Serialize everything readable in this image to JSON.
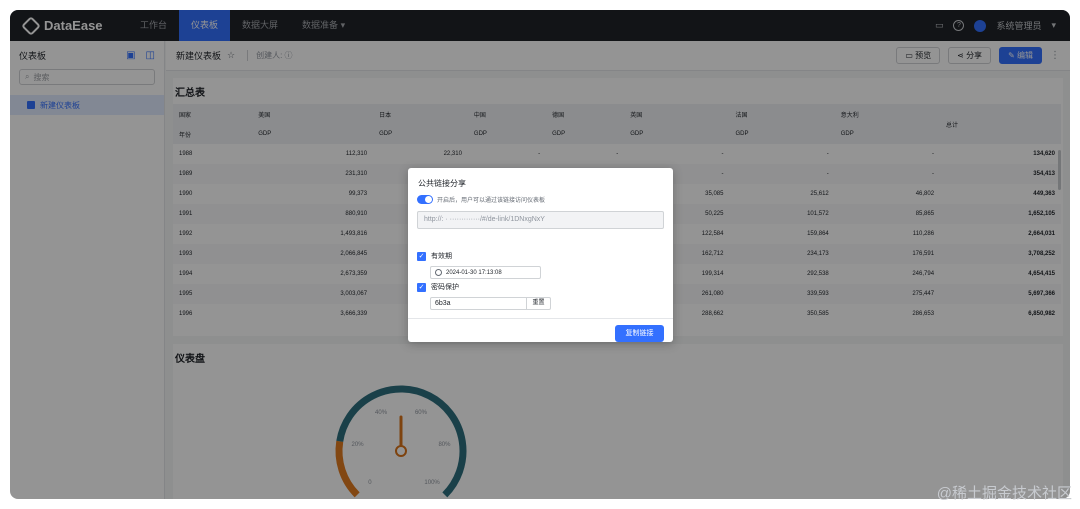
{
  "brand": {
    "name": "DataEase"
  },
  "nav": {
    "items": [
      {
        "label": "工作台",
        "active": false
      },
      {
        "label": "仪表板",
        "active": true
      },
      {
        "label": "数据大屏",
        "active": false
      },
      {
        "label": "数据准备",
        "active": false
      }
    ],
    "user_name": "系统管理员"
  },
  "sidebar": {
    "title": "仪表板",
    "search_placeholder": "搜索",
    "items": [
      {
        "label": "新建仪表板"
      }
    ]
  },
  "header": {
    "title": "新建仪表板",
    "creator_label": "创建人: ",
    "preview_label": "预览",
    "share_label": "分享",
    "edit_label": "编辑"
  },
  "table_card": {
    "title": "汇总表",
    "country_label": "国家",
    "year_label": "年份",
    "total_label": "总计",
    "countries": [
      "美国",
      "日本",
      "中国",
      "德国",
      "英国",
      "法国",
      "意大利"
    ],
    "measure": "GDP",
    "rows": [
      {
        "year": "1988",
        "c1": "112,310",
        "c2": "22,310",
        "c3": "-",
        "c4": "-",
        "c5": "-",
        "c6": "-",
        "c7": "-",
        "total": "134,620"
      },
      {
        "year": "1989",
        "c1": "231,310",
        "c2": "",
        "c3": "",
        "c4": "",
        "c5": "-",
        "c6": "-",
        "c7": "-",
        "total": "354,413"
      },
      {
        "year": "1990",
        "c1": "99,373",
        "c2": "",
        "c3": "",
        "c4": "",
        "c5": "35,085",
        "c6": "25,612",
        "c7": "46,802",
        "total": "449,363"
      },
      {
        "year": "1991",
        "c1": "880,910",
        "c2": "",
        "c3": "",
        "c4": "",
        "c5": "50,225",
        "c6": "101,572",
        "c7": "85,865",
        "total": "1,652,105"
      },
      {
        "year": "1992",
        "c1": "1,493,816",
        "c2": "",
        "c3": "",
        "c4": "",
        "c5": "122,584",
        "c6": "159,864",
        "c7": "110,286",
        "total": "2,664,031"
      },
      {
        "year": "1993",
        "c1": "2,066,845",
        "c2": "",
        "c3": "",
        "c4": "",
        "c5": "162,712",
        "c6": "234,173",
        "c7": "176,591",
        "total": "3,708,252"
      },
      {
        "year": "1994",
        "c1": "2,673,359",
        "c2": "",
        "c3": "",
        "c4": "",
        "c5": "199,314",
        "c6": "292,538",
        "c7": "246,794",
        "total": "4,654,415"
      },
      {
        "year": "1995",
        "c1": "3,003,067",
        "c2": "",
        "c3": "",
        "c4": "",
        "c5": "261,080",
        "c6": "339,593",
        "c7": "275,447",
        "total": "5,697,366"
      },
      {
        "year": "1996",
        "c1": "3,666,339",
        "c2": "",
        "c3": "",
        "c4": "",
        "c5": "288,662",
        "c6": "350,585",
        "c7": "286,653",
        "total": "6,850,982"
      }
    ]
  },
  "gauge_card": {
    "title": "仪表盘",
    "ticks": [
      "0",
      "20%",
      "40%",
      "60%",
      "80%",
      "100%"
    ],
    "value_fraction": 0.5,
    "colors": {
      "low": "#e07b20",
      "high": "#2e6f7e",
      "pointer": "#d9741a"
    }
  },
  "dialog": {
    "title": "公共链接分享",
    "toggle_text": "开启后，用户可以通过该链接访问仪表板",
    "link_text": "http://:  ·  ·············/#/de-link/1DNxgNxY",
    "expiry_label": "有效期",
    "expiry_value": "2024-01-30 17:13:08",
    "password_label": "密码保护",
    "password_value": "6b3a",
    "reset_label": "重置",
    "copy_label": "复制链接"
  },
  "watermark": "@稀土掘金技术社区"
}
